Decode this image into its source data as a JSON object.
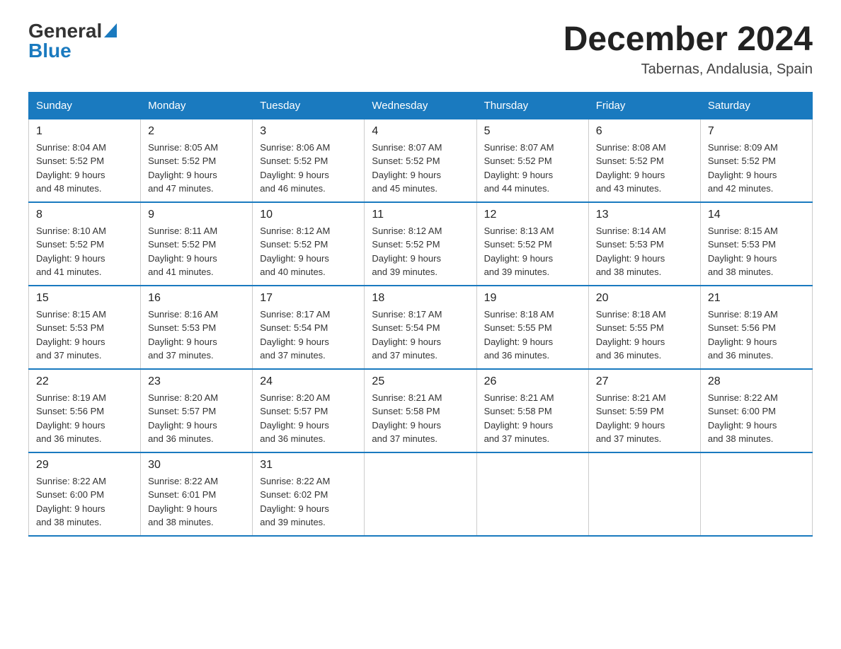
{
  "logo": {
    "general": "General",
    "blue": "Blue",
    "triangle": "▲"
  },
  "title": "December 2024",
  "location": "Tabernas, Andalusia, Spain",
  "days_of_week": [
    "Sunday",
    "Monday",
    "Tuesday",
    "Wednesday",
    "Thursday",
    "Friday",
    "Saturday"
  ],
  "weeks": [
    [
      {
        "day": "1",
        "info": "Sunrise: 8:04 AM\nSunset: 5:52 PM\nDaylight: 9 hours\nand 48 minutes."
      },
      {
        "day": "2",
        "info": "Sunrise: 8:05 AM\nSunset: 5:52 PM\nDaylight: 9 hours\nand 47 minutes."
      },
      {
        "day": "3",
        "info": "Sunrise: 8:06 AM\nSunset: 5:52 PM\nDaylight: 9 hours\nand 46 minutes."
      },
      {
        "day": "4",
        "info": "Sunrise: 8:07 AM\nSunset: 5:52 PM\nDaylight: 9 hours\nand 45 minutes."
      },
      {
        "day": "5",
        "info": "Sunrise: 8:07 AM\nSunset: 5:52 PM\nDaylight: 9 hours\nand 44 minutes."
      },
      {
        "day": "6",
        "info": "Sunrise: 8:08 AM\nSunset: 5:52 PM\nDaylight: 9 hours\nand 43 minutes."
      },
      {
        "day": "7",
        "info": "Sunrise: 8:09 AM\nSunset: 5:52 PM\nDaylight: 9 hours\nand 42 minutes."
      }
    ],
    [
      {
        "day": "8",
        "info": "Sunrise: 8:10 AM\nSunset: 5:52 PM\nDaylight: 9 hours\nand 41 minutes."
      },
      {
        "day": "9",
        "info": "Sunrise: 8:11 AM\nSunset: 5:52 PM\nDaylight: 9 hours\nand 41 minutes."
      },
      {
        "day": "10",
        "info": "Sunrise: 8:12 AM\nSunset: 5:52 PM\nDaylight: 9 hours\nand 40 minutes."
      },
      {
        "day": "11",
        "info": "Sunrise: 8:12 AM\nSunset: 5:52 PM\nDaylight: 9 hours\nand 39 minutes."
      },
      {
        "day": "12",
        "info": "Sunrise: 8:13 AM\nSunset: 5:52 PM\nDaylight: 9 hours\nand 39 minutes."
      },
      {
        "day": "13",
        "info": "Sunrise: 8:14 AM\nSunset: 5:53 PM\nDaylight: 9 hours\nand 38 minutes."
      },
      {
        "day": "14",
        "info": "Sunrise: 8:15 AM\nSunset: 5:53 PM\nDaylight: 9 hours\nand 38 minutes."
      }
    ],
    [
      {
        "day": "15",
        "info": "Sunrise: 8:15 AM\nSunset: 5:53 PM\nDaylight: 9 hours\nand 37 minutes."
      },
      {
        "day": "16",
        "info": "Sunrise: 8:16 AM\nSunset: 5:53 PM\nDaylight: 9 hours\nand 37 minutes."
      },
      {
        "day": "17",
        "info": "Sunrise: 8:17 AM\nSunset: 5:54 PM\nDaylight: 9 hours\nand 37 minutes."
      },
      {
        "day": "18",
        "info": "Sunrise: 8:17 AM\nSunset: 5:54 PM\nDaylight: 9 hours\nand 37 minutes."
      },
      {
        "day": "19",
        "info": "Sunrise: 8:18 AM\nSunset: 5:55 PM\nDaylight: 9 hours\nand 36 minutes."
      },
      {
        "day": "20",
        "info": "Sunrise: 8:18 AM\nSunset: 5:55 PM\nDaylight: 9 hours\nand 36 minutes."
      },
      {
        "day": "21",
        "info": "Sunrise: 8:19 AM\nSunset: 5:56 PM\nDaylight: 9 hours\nand 36 minutes."
      }
    ],
    [
      {
        "day": "22",
        "info": "Sunrise: 8:19 AM\nSunset: 5:56 PM\nDaylight: 9 hours\nand 36 minutes."
      },
      {
        "day": "23",
        "info": "Sunrise: 8:20 AM\nSunset: 5:57 PM\nDaylight: 9 hours\nand 36 minutes."
      },
      {
        "day": "24",
        "info": "Sunrise: 8:20 AM\nSunset: 5:57 PM\nDaylight: 9 hours\nand 36 minutes."
      },
      {
        "day": "25",
        "info": "Sunrise: 8:21 AM\nSunset: 5:58 PM\nDaylight: 9 hours\nand 37 minutes."
      },
      {
        "day": "26",
        "info": "Sunrise: 8:21 AM\nSunset: 5:58 PM\nDaylight: 9 hours\nand 37 minutes."
      },
      {
        "day": "27",
        "info": "Sunrise: 8:21 AM\nSunset: 5:59 PM\nDaylight: 9 hours\nand 37 minutes."
      },
      {
        "day": "28",
        "info": "Sunrise: 8:22 AM\nSunset: 6:00 PM\nDaylight: 9 hours\nand 38 minutes."
      }
    ],
    [
      {
        "day": "29",
        "info": "Sunrise: 8:22 AM\nSunset: 6:00 PM\nDaylight: 9 hours\nand 38 minutes."
      },
      {
        "day": "30",
        "info": "Sunrise: 8:22 AM\nSunset: 6:01 PM\nDaylight: 9 hours\nand 38 minutes."
      },
      {
        "day": "31",
        "info": "Sunrise: 8:22 AM\nSunset: 6:02 PM\nDaylight: 9 hours\nand 39 minutes."
      },
      null,
      null,
      null,
      null
    ]
  ]
}
